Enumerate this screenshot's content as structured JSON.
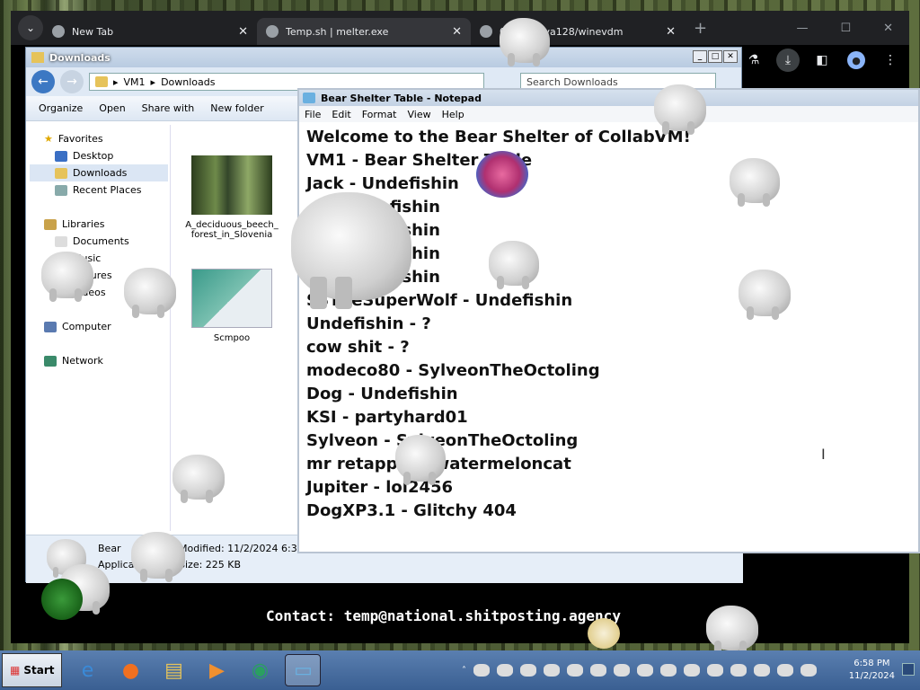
{
  "browser": {
    "tabs": [
      {
        "title": "New Tab",
        "active": false
      },
      {
        "title": "Temp.sh | melter.exe",
        "active": true
      },
      {
        "title": "0.9.0 · otya128/winevdm",
        "active": false
      }
    ]
  },
  "explorer": {
    "title": "Downloads",
    "breadcrumb": [
      "VM1",
      "Downloads"
    ],
    "search_placeholder": "Search Downloads",
    "commands": [
      "Organize",
      "Open",
      "Share with",
      "New folder"
    ],
    "nav": {
      "favorites": {
        "label": "Favorites",
        "items": [
          "Desktop",
          "Downloads",
          "Recent Places"
        ]
      },
      "libraries": {
        "label": "Libraries",
        "items": [
          "Documents",
          "Music",
          "Pictures",
          "Videos"
        ]
      },
      "computer": "Computer",
      "network": "Network"
    },
    "files": [
      {
        "name": "A_deciduous_beech_forest_in_Slovenia"
      },
      {
        "name": "Scmpoo"
      }
    ],
    "details": {
      "name": "Bear",
      "type": "Application",
      "modified": "Modified: 11/2/2024 6:35 PM",
      "size": "Size: 225 KB"
    }
  },
  "notepad": {
    "title": "Bear Shelter Table - Notepad",
    "menu": [
      "File",
      "Edit",
      "Format",
      "View",
      "Help"
    ],
    "lines": [
      "Welcome to the Bear Shelter of CollabVM!",
      "VM1 - Bear Shelter Table",
      "Jack - Undefishin",
      "... - Undefishin",
      "... - Undefishin",
      "... - Undefishin",
      "... - Undefishin",
      "SSTheSuperWolf - Undefishin",
      "Undefishin - ?",
      "cow shit - ?",
      "modeco80 - SylveonTheOctoling",
      "Dog - Undefishin",
      "KSI - partyhard01",
      "Sylveon - SylveonTheOctoling",
      "mr retapper - watermeloncat",
      "Jupiter - lol2456",
      "DogXP3.1 - Glitchy 404"
    ]
  },
  "contact": "Contact: temp@national.shitposting.agency",
  "taskbar": {
    "start_label": "Start",
    "time": "6:58 PM",
    "date": "11/2/2024"
  }
}
